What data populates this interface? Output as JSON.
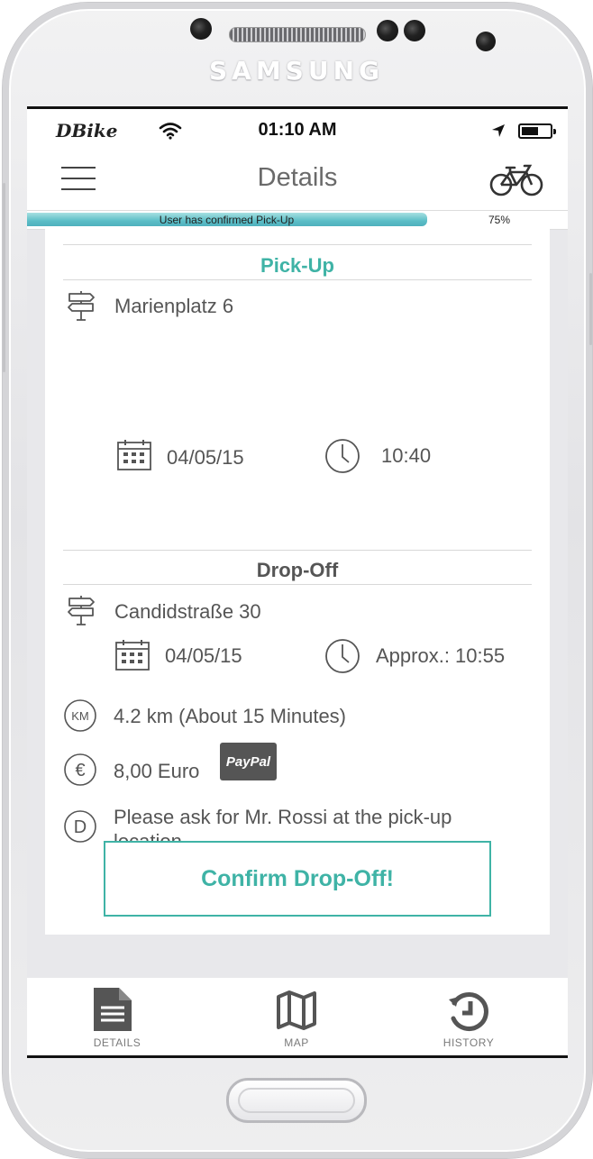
{
  "device": {
    "brand": "SAMSUNG"
  },
  "status_bar": {
    "carrier": "DBike",
    "time": "01:10 AM"
  },
  "nav": {
    "title": "Details"
  },
  "progress": {
    "label": "User has confirmed Pick-Up",
    "percent_text": "75%",
    "value": 0.75
  },
  "pickup": {
    "title": "Pick-Up",
    "address": "Marienplatz 6",
    "date": "04/05/15",
    "time": "10:40"
  },
  "dropoff": {
    "title": "Drop-Off",
    "address": "Candidstraße 30",
    "date": "04/05/15",
    "time": "Approx.: 10:55"
  },
  "distance": {
    "icon_text": "KM",
    "text": "4.2 km (About 15 Minutes)"
  },
  "price": {
    "icon_text": "€",
    "text": "8,00 Euro",
    "payment_method": "PayPal"
  },
  "note": {
    "icon_text": "D",
    "line1": "Please ask for Mr. Rossi at the pick-up",
    "line2": "location"
  },
  "actions": {
    "confirm_label": "Confirm Drop-Off!"
  },
  "tabs": [
    {
      "label": "DETAILS",
      "icon": "document-icon",
      "active": true
    },
    {
      "label": "MAP",
      "icon": "map-icon",
      "active": false
    },
    {
      "label": "HISTORY",
      "icon": "history-icon",
      "active": false
    }
  ],
  "colors": {
    "accent": "#3fb3a6",
    "progress": "#5cbec7",
    "text": "#555555"
  }
}
